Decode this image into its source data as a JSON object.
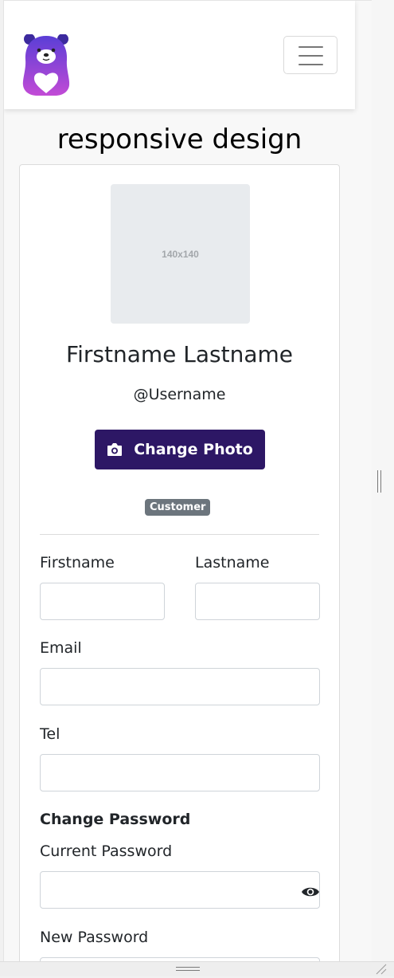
{
  "brand": {
    "logo_icon": "bear-heart-logo-icon",
    "colors": {
      "logo_top": "#5a3ed6",
      "logo_bottom": "#c24bd6"
    }
  },
  "navbar": {
    "toggler_icon": "hamburger-menu-icon"
  },
  "page": {
    "heading": "responsive design"
  },
  "profile": {
    "image_placeholder": "140x140",
    "name": "Firstname Lastname",
    "username": "@Username",
    "change_photo_label": "Change Photo",
    "change_photo_icon": "camera-icon",
    "role_badge": "Customer",
    "colors": {
      "button": "#2d1765",
      "badge": "#6c757d"
    }
  },
  "form": {
    "firstname_label": "Firstname",
    "firstname_value": "",
    "lastname_label": "Lastname",
    "lastname_value": "",
    "email_label": "Email",
    "email_value": "",
    "tel_label": "Tel",
    "tel_value": "",
    "password_section_title": "Change Password",
    "current_password_label": "Current Password",
    "current_password_value": "",
    "show_password_icon": "eye-icon",
    "new_password_label": "New Password",
    "new_password_value": ""
  }
}
